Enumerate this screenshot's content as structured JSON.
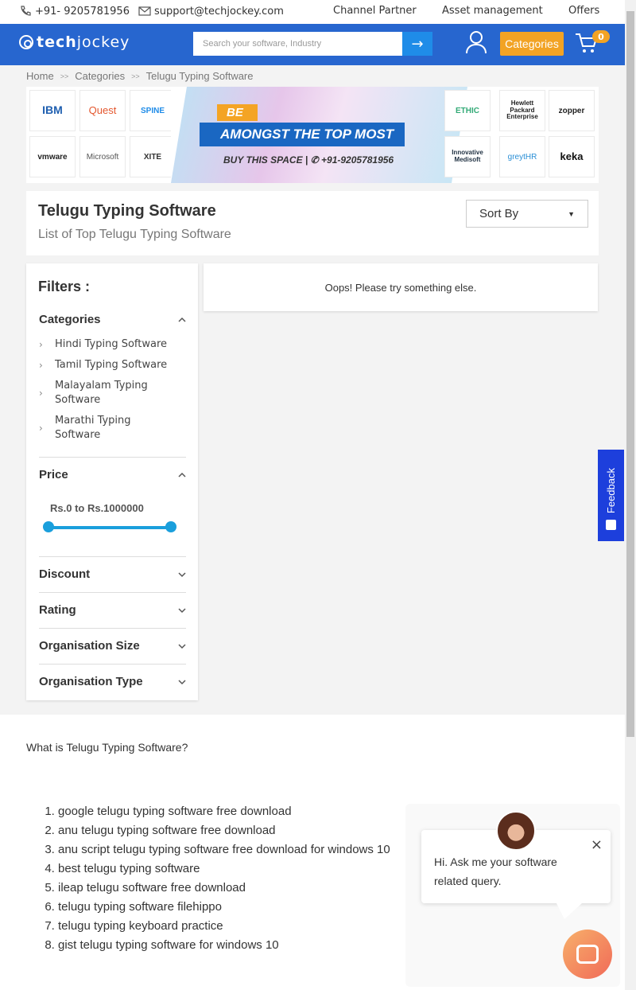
{
  "topbar": {
    "phone": "+91- 9205781956",
    "email": "support@techjockey.com",
    "links": [
      "Channel Partner",
      "Asset management",
      "Offers"
    ]
  },
  "header": {
    "logo_part1": "tech",
    "logo_part2": "jockey",
    "search_placeholder": "Search your software, Industry",
    "categories_label": "Categories",
    "cart_count": "0",
    "brand_color": "#2766cf",
    "accent_color": "#f2a324"
  },
  "breadcrumb": [
    "Home",
    "Categories",
    "Telugu Typing Software"
  ],
  "breadcrumb_sep": ">>",
  "banner": {
    "logos_left": [
      "IBM",
      "Quest",
      "SPINE",
      "vmware",
      "Microsoft",
      "XITE"
    ],
    "logos_right": [
      "ETHIC",
      "Hewlett Packard Enterprise",
      "zopper",
      "Innovative Medisoft",
      "greytHR",
      "keka"
    ],
    "promo_be": "BE",
    "promo_head": "AMONGST THE TOP MOST",
    "promo_sub": "BUY THIS SPACE",
    "promo_phone": "+91-9205781956"
  },
  "title": {
    "heading": "Telugu Typing Software",
    "subheading": "List of Top Telugu Typing Software",
    "sort_label": "Sort By"
  },
  "filters": {
    "heading": "Filters :",
    "categories_label": "Categories",
    "category_items": [
      "Hindi Typing Software",
      "Tamil Typing Software",
      "Malayalam Typing Software",
      "Marathi Typing Software"
    ],
    "price_label": "Price",
    "price_range": "Rs.0 to Rs.1000000",
    "collapsed": [
      "Discount",
      "Rating",
      "Organisation Size",
      "Organisation Type"
    ]
  },
  "results": {
    "empty_message": "Oops! Please try something else."
  },
  "feedback_label": "Feedback",
  "faq": {
    "question": "What is Telugu Typing Software?",
    "items": [
      "google telugu typing software free download",
      "anu telugu typing software free download",
      "anu script telugu typing software free download for windows 10",
      "best telugu typing software",
      "ileap telugu software free download",
      "telugu typing software filehippo",
      "telugu typing keyboard practice",
      "gist telugu typing software for windows 10"
    ]
  },
  "chat": {
    "message": "Hi. Ask me your software related query.",
    "close": "×"
  }
}
